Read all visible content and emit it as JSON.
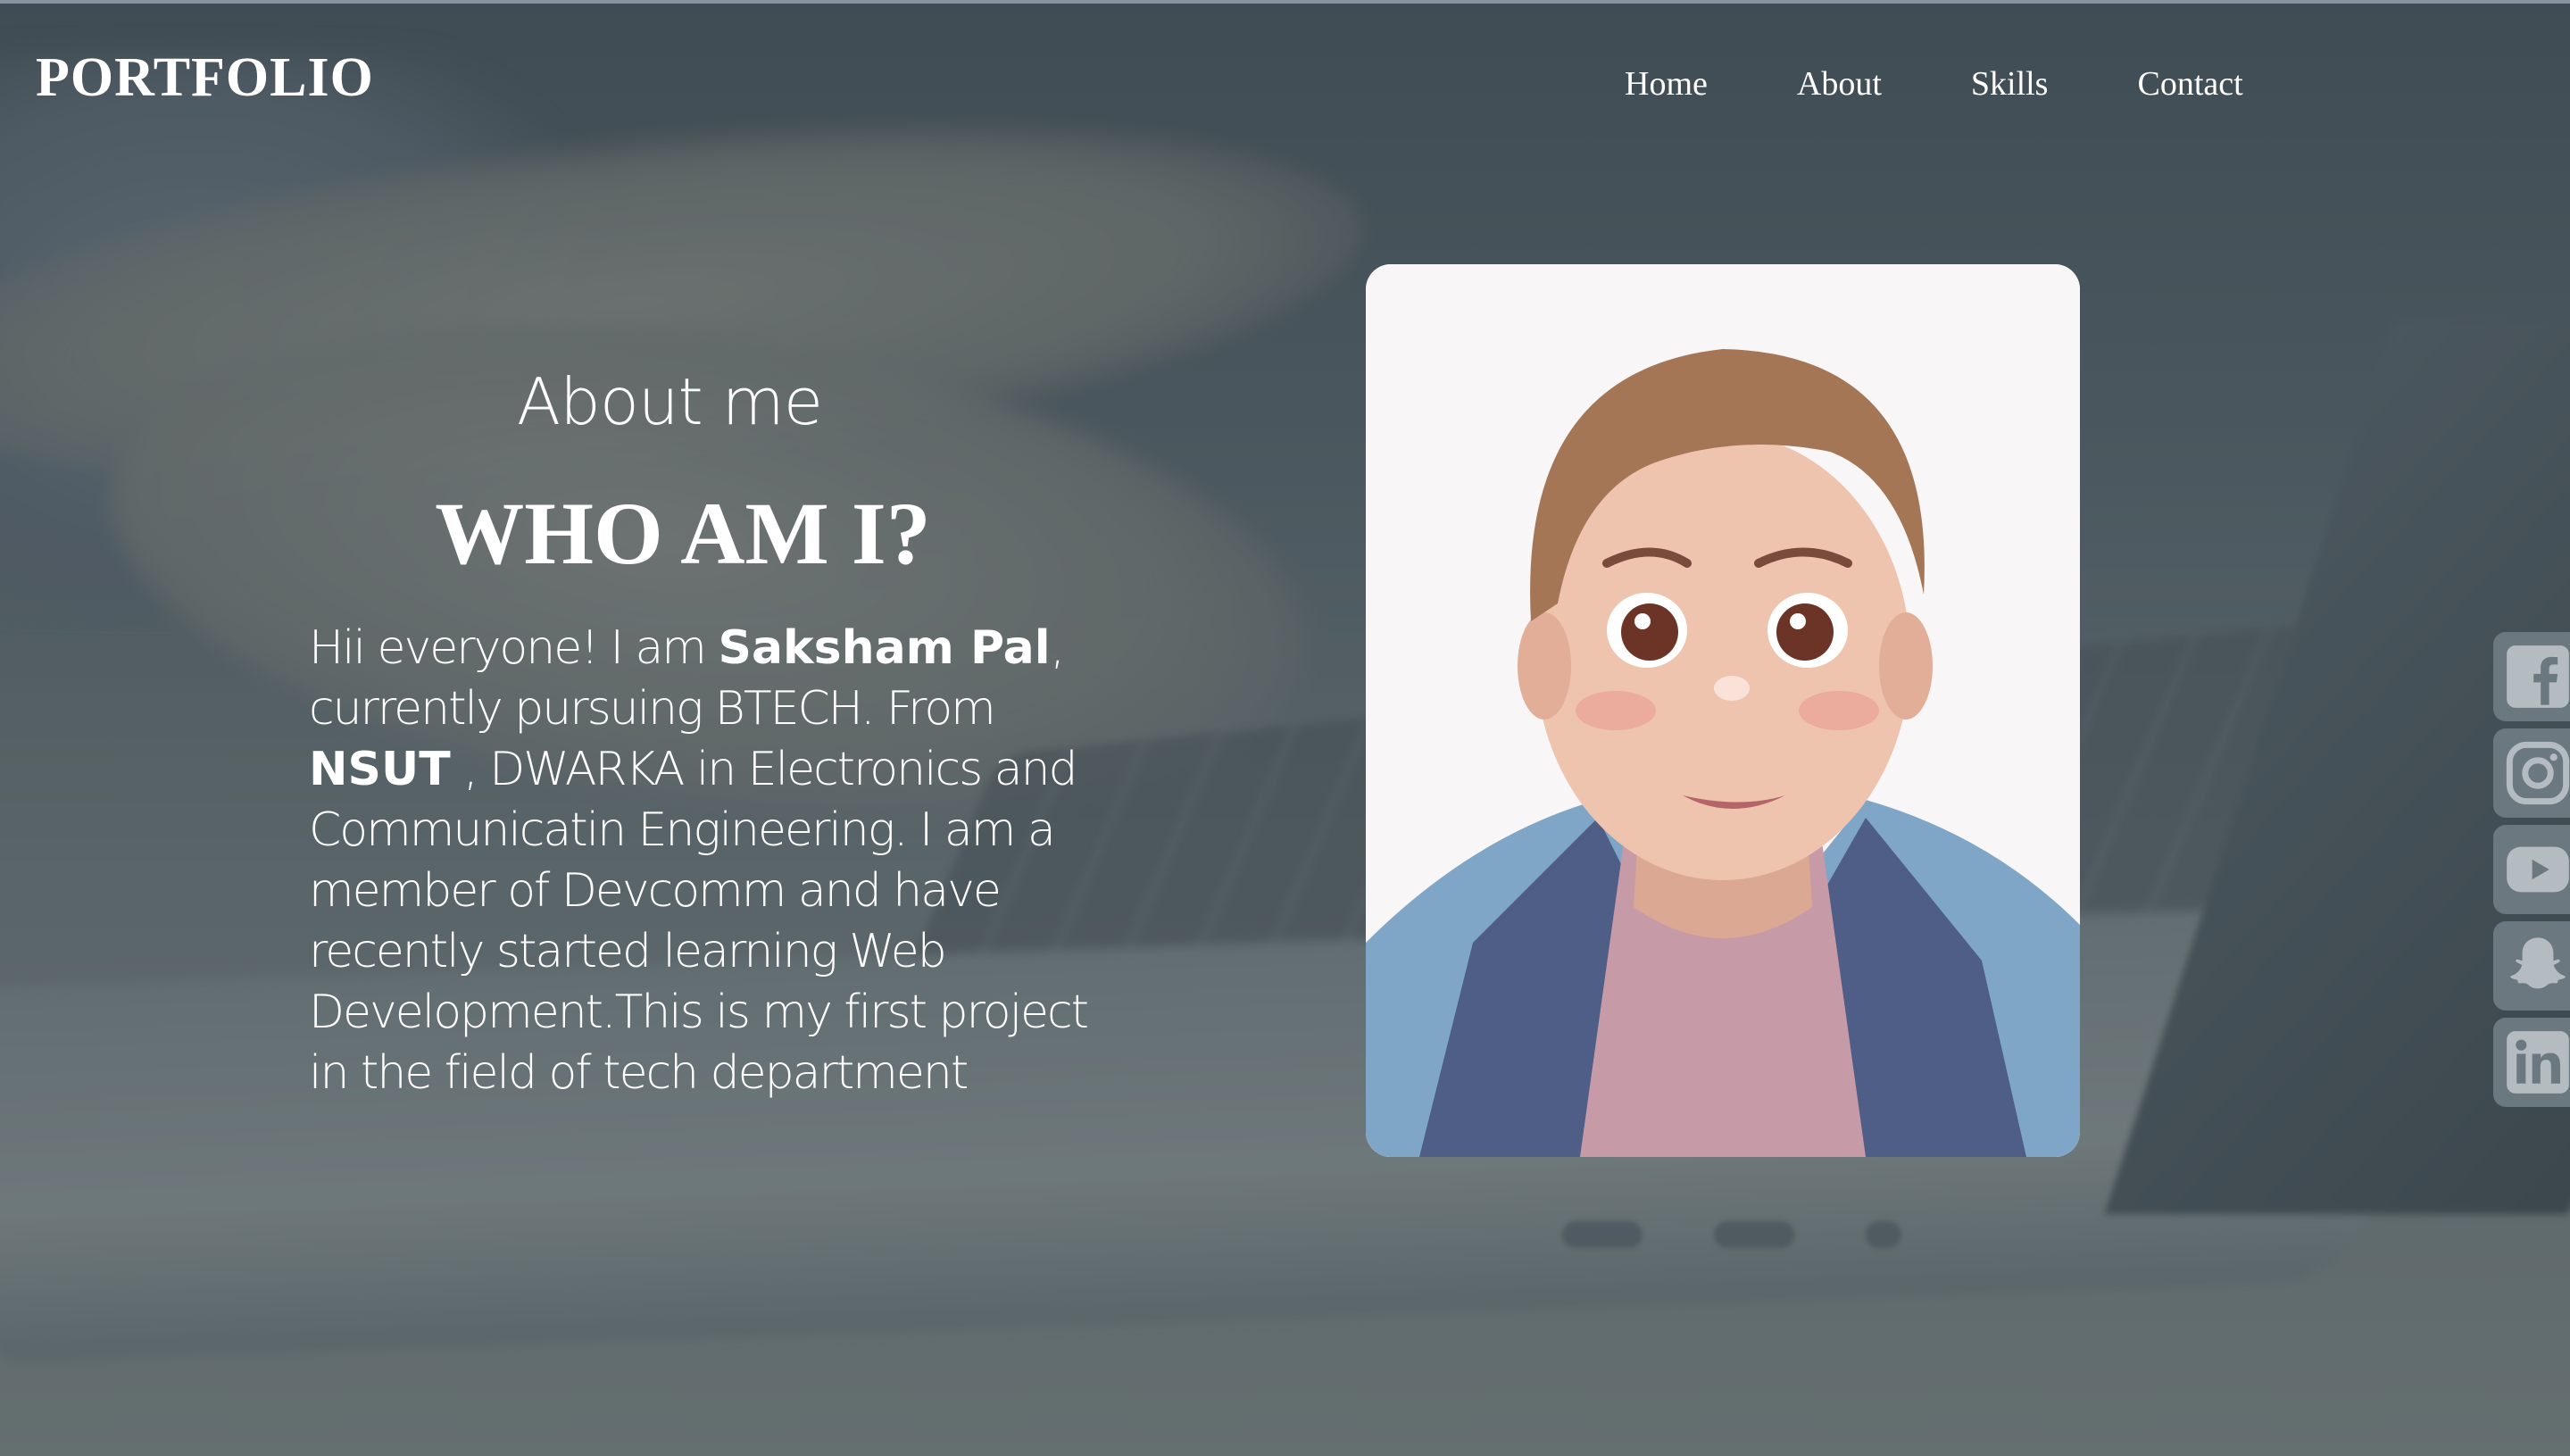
{
  "header": {
    "logo": "PORTFOLIO",
    "nav": [
      "Home",
      "About",
      "Skills",
      "Contact"
    ]
  },
  "about": {
    "subtitle": "About me",
    "title": "WHO AM I?",
    "intro_prefix": "Hii everyone! I am ",
    "name": "Saksham Pal",
    "intro_after_name": ", currently pursuing BTECH. From ",
    "college": "NSUT",
    "intro_rest": " , DWARKA in Electronics and Communicatin Engineering. I am a member of Devcomm and have recently started learning Web Development.This is my first project in the field of tech department"
  },
  "social": [
    {
      "icon": "facebook-icon"
    },
    {
      "icon": "instagram-icon"
    },
    {
      "icon": "youtube-icon"
    },
    {
      "icon": "snapchat-icon"
    },
    {
      "icon": "linkedin-icon"
    }
  ],
  "colors": {
    "text": "#ffffff",
    "social_bg": "#6c7880",
    "background": "#5f6a70"
  }
}
